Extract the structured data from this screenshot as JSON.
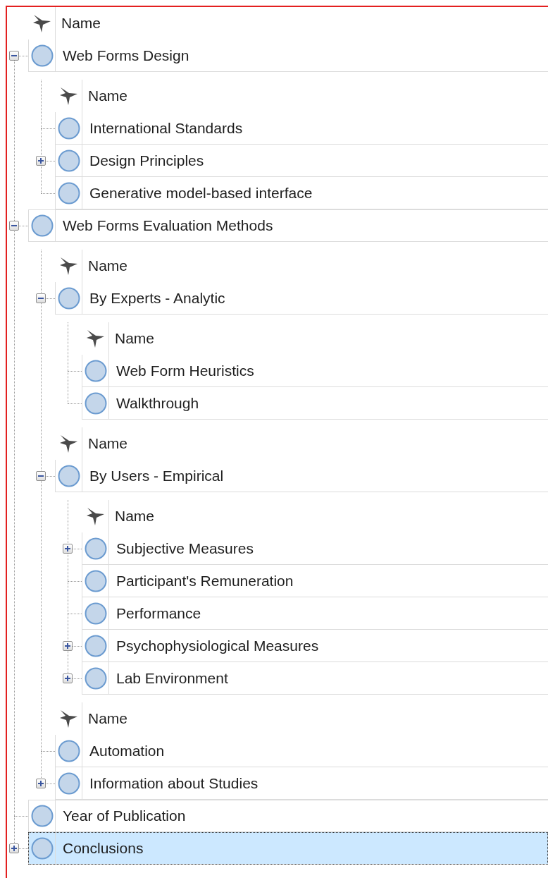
{
  "tree": {
    "header": "Name",
    "rows": [
      {
        "label": "Web Forms Design",
        "expanded": true,
        "selected": false,
        "bands": [
          {
            "header": "Name",
            "rows": [
              {
                "label": "International Standards",
                "selected": false
              },
              {
                "label": "Design Principles",
                "expanded": false,
                "selected": false
              },
              {
                "label": "Generative model-based interface",
                "selected": false
              }
            ]
          }
        ]
      },
      {
        "label": "Web Forms Evaluation Methods",
        "expanded": true,
        "selected": false,
        "bands": [
          {
            "header": "Name",
            "rows": [
              {
                "label": "By Experts - Analytic",
                "expanded": true,
                "selected": false,
                "bands": [
                  {
                    "header": "Name",
                    "rows": [
                      {
                        "label": "Web Form Heuristics",
                        "selected": false
                      },
                      {
                        "label": "Walkthrough",
                        "selected": false
                      }
                    ]
                  }
                ]
              }
            ]
          },
          {
            "header": "Name",
            "rows": [
              {
                "label": "By Users - Empirical",
                "expanded": true,
                "selected": false,
                "bands": [
                  {
                    "header": "Name",
                    "rows": [
                      {
                        "label": "Subjective Measures",
                        "expanded": false,
                        "selected": false
                      },
                      {
                        "label": "Participant's Remuneration",
                        "selected": false
                      },
                      {
                        "label": "Performance",
                        "selected": false
                      },
                      {
                        "label": "Psychophysiological Measures",
                        "expanded": false,
                        "selected": false
                      },
                      {
                        "label": "Lab Environment",
                        "expanded": false,
                        "selected": false
                      }
                    ]
                  }
                ]
              }
            ]
          },
          {
            "header": "Name",
            "rows": [
              {
                "label": "Automation",
                "selected": false
              },
              {
                "label": "Information about Studies",
                "expanded": false,
                "selected": false
              }
            ]
          }
        ]
      },
      {
        "label": "Year of Publication",
        "selected": false
      },
      {
        "label": "Conclusions",
        "expanded": false,
        "selected": true
      }
    ]
  }
}
